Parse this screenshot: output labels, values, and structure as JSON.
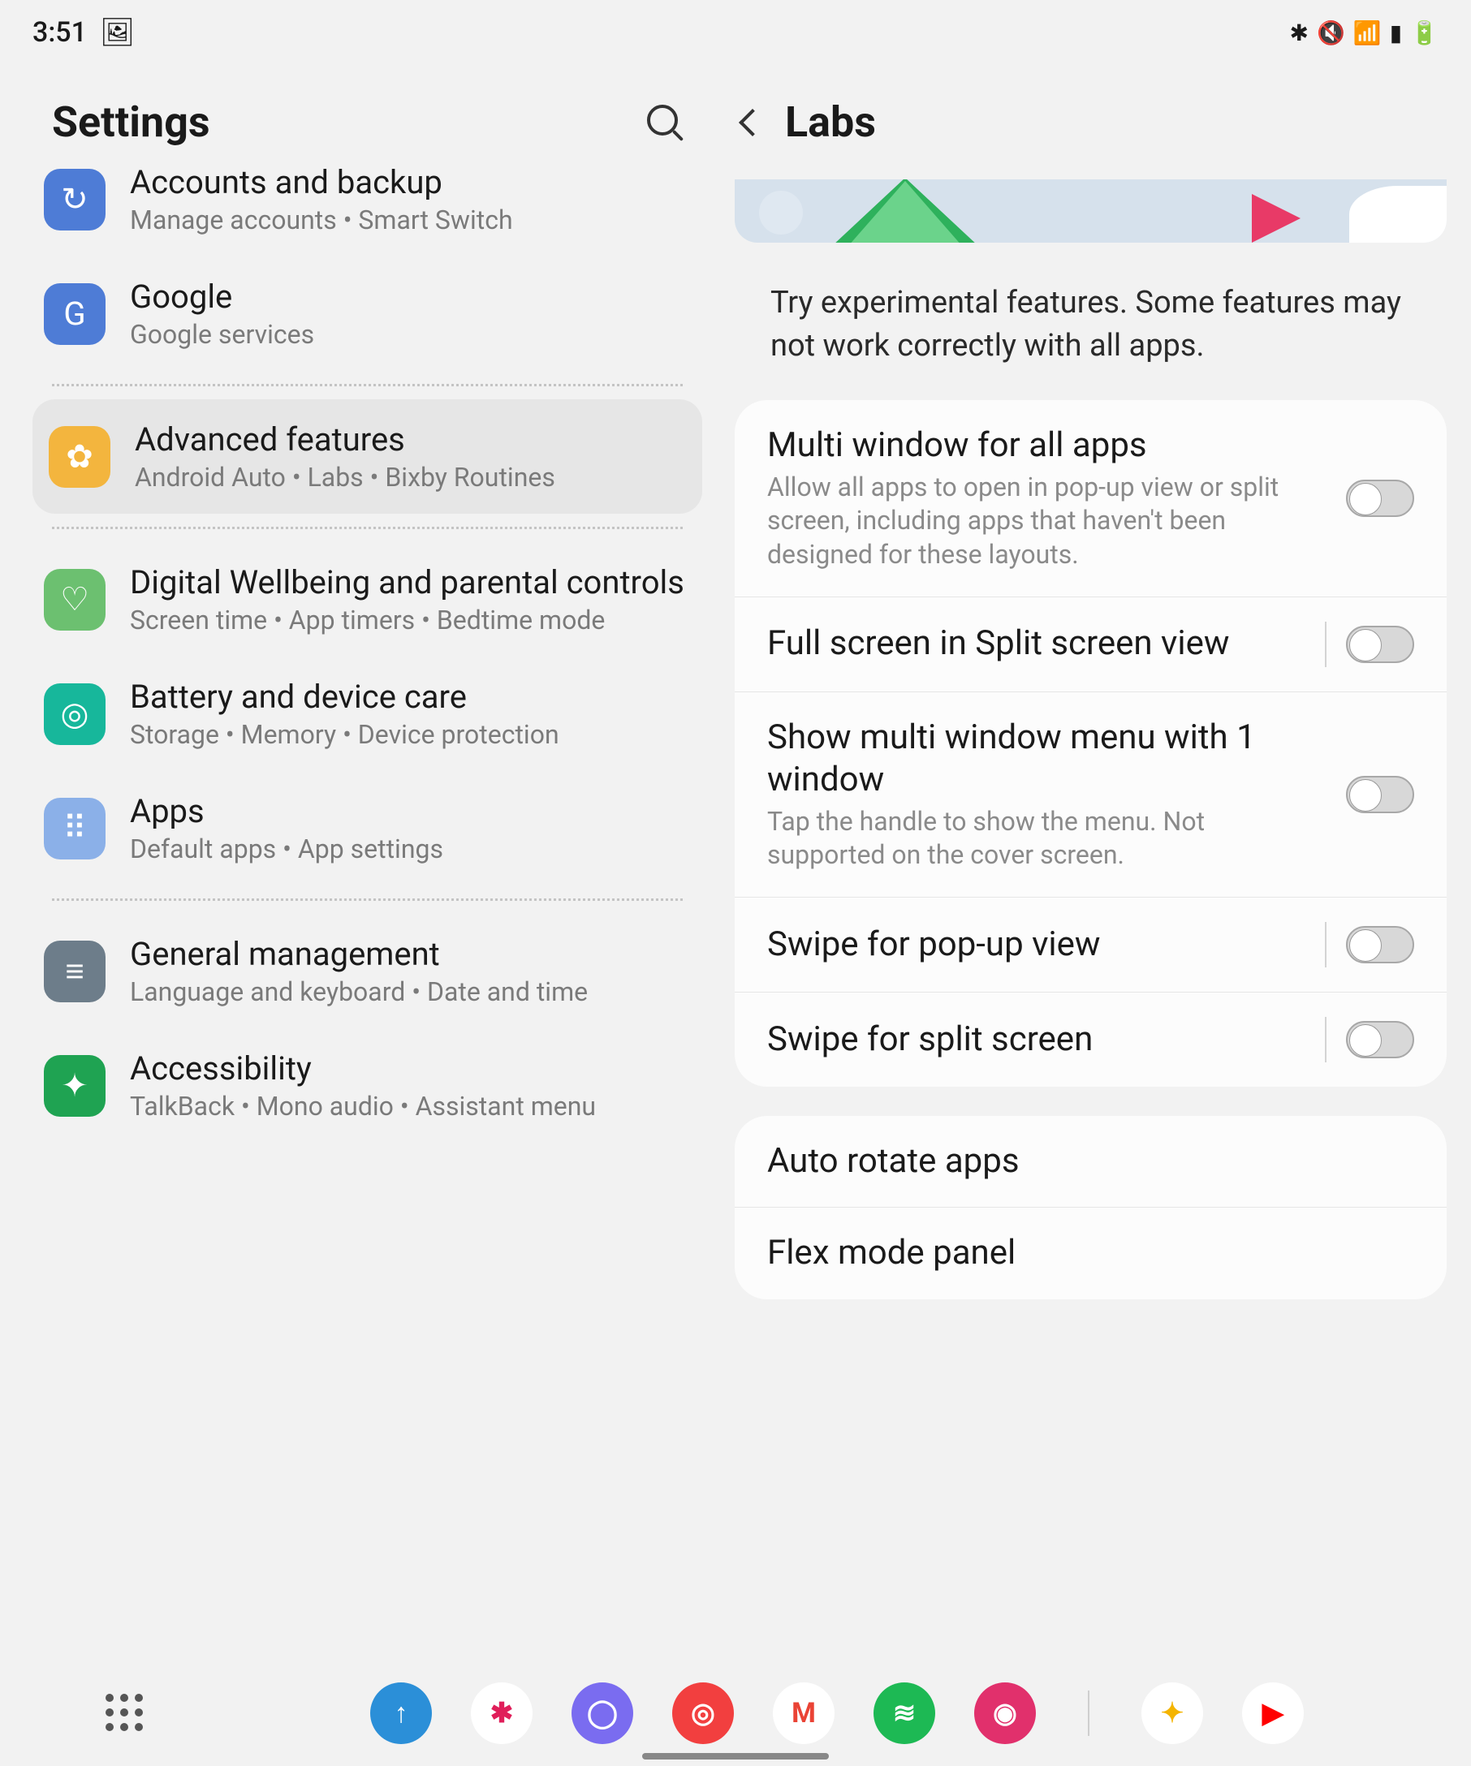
{
  "status": {
    "time": "3:51",
    "icons": [
      "bluetooth",
      "mute",
      "wifi",
      "signal",
      "battery"
    ]
  },
  "left": {
    "title": "Settings",
    "items": [
      {
        "id": "accounts",
        "title": "Accounts and backup",
        "subtitle": "Manage accounts  •  Smart Switch",
        "color": "#4e7cd6",
        "glyph": "↻",
        "truncated": true
      },
      {
        "id": "google",
        "title": "Google",
        "subtitle": "Google services",
        "color": "#4e7cd6",
        "glyph": "G"
      },
      {
        "divider": true
      },
      {
        "id": "advanced",
        "title": "Advanced features",
        "subtitle": "Android Auto  •  Labs  •  Bixby Routines",
        "color": "#f3b53e",
        "glyph": "✿",
        "selected": true
      },
      {
        "divider": true
      },
      {
        "id": "wellbeing",
        "title": "Digital Wellbeing and parental controls",
        "subtitle": "Screen time  •  App timers  •  Bedtime mode",
        "color": "#6cc070",
        "glyph": "♡"
      },
      {
        "id": "battery",
        "title": "Battery and device care",
        "subtitle": "Storage  •  Memory  •  Device protection",
        "color": "#17b79b",
        "glyph": "◎"
      },
      {
        "id": "apps",
        "title": "Apps",
        "subtitle": "Default apps  •  App settings",
        "color": "#8bb0e8",
        "glyph": "⠿"
      },
      {
        "divider": true
      },
      {
        "id": "general",
        "title": "General management",
        "subtitle": "Language and keyboard  •  Date and time",
        "color": "#6d7d8a",
        "glyph": "≡"
      },
      {
        "id": "accessibility",
        "title": "Accessibility",
        "subtitle": "TalkBack  •  Mono audio  •  Assistant menu",
        "color": "#1fa352",
        "glyph": "✦"
      }
    ]
  },
  "right": {
    "title": "Labs",
    "description": "Try experimental features. Some features may not work correctly with all apps.",
    "groups": [
      [
        {
          "id": "multi-window-all",
          "title": "Multi window for all apps",
          "sub": "Allow all apps to open in pop-up view or split screen, including apps that haven't been designed for these layouts.",
          "toggle": false
        },
        {
          "id": "full-screen-split",
          "title": "Full screen in Split screen view",
          "toggle": false,
          "sep": true
        },
        {
          "id": "multi-window-menu",
          "title": "Show multi window menu with 1 window",
          "sub": "Tap the handle to show the menu. Not supported on the cover screen.",
          "toggle": false
        },
        {
          "id": "swipe-popup",
          "title": "Swipe for pop-up view",
          "toggle": false,
          "sep": true
        },
        {
          "id": "swipe-split",
          "title": "Swipe for split screen",
          "toggle": false,
          "sep": true
        }
      ],
      [
        {
          "id": "auto-rotate",
          "title": "Auto rotate apps"
        },
        {
          "id": "flex-mode",
          "title": "Flex mode panel"
        }
      ]
    ]
  },
  "dock": {
    "apps": [
      {
        "name": "upload",
        "color": "#2b8fd8",
        "glyph": "↑"
      },
      {
        "name": "slack",
        "color": "#ffffff",
        "glyph": "✱",
        "fg": "#e01e5a"
      },
      {
        "name": "browser",
        "color": "#7a6cf0",
        "glyph": "◯"
      },
      {
        "name": "pocketcasts",
        "color": "#f23f3f",
        "glyph": "◎"
      },
      {
        "name": "gmail",
        "color": "#ffffff",
        "glyph": "M",
        "fg": "#ea4335"
      },
      {
        "name": "spotify",
        "color": "#1db954",
        "glyph": "≋"
      },
      {
        "name": "instagram",
        "color": "#e1306c",
        "glyph": "◉"
      }
    ],
    "recent": [
      {
        "name": "photos",
        "color": "#ffffff",
        "glyph": "✦",
        "fg": "#f4b400"
      },
      {
        "name": "youtube",
        "color": "#ffffff",
        "glyph": "▶",
        "fg": "#ff0000"
      }
    ]
  }
}
